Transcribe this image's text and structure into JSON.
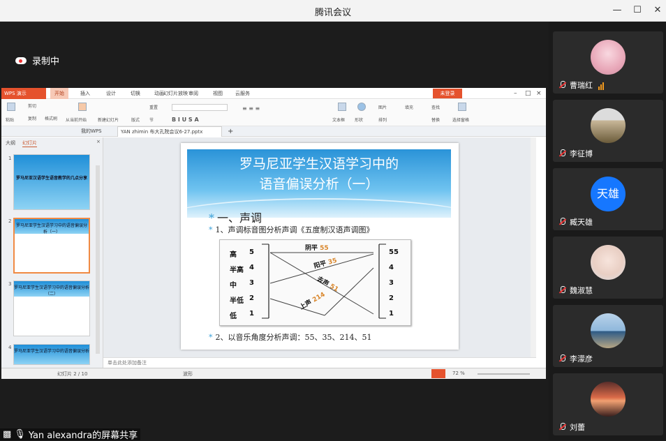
{
  "window": {
    "title": "腾讯会议"
  },
  "recording": {
    "label": "录制中"
  },
  "share_banner": {
    "label": "Yan alexandra的屏幕共享"
  },
  "wps": {
    "logo": "WPS 演示",
    "menus": [
      "开始",
      "插入",
      "设计",
      "切换",
      "动画",
      "幻灯片放映",
      "审阅",
      "视图",
      "云服务"
    ],
    "login": "未登录",
    "ribbon": [
      "粘贴",
      "剪切",
      "复制",
      "格式刷",
      "从当前开始",
      "新建幻灯片",
      "版式",
      "节",
      "重置",
      "文本框",
      "形状",
      "排列",
      "图片",
      "填充",
      "查找",
      "替换",
      "选择窗格"
    ],
    "doc_tabs": [
      "我的WPS",
      "YAN zhimin 布大孔院会议6-27.pptx"
    ],
    "pane_tabs": [
      "大纲",
      "幻灯片"
    ],
    "status": {
      "slide_counter": "幻灯片 2 / 10",
      "theme": "波形",
      "zoom": "72 %",
      "notes_hint": "单击此处添加备注"
    }
  },
  "slide": {
    "title_line1": "罗马尼亚学生汉语学习中的",
    "title_line2": "语音偏误分析（一）",
    "section": "一、声调",
    "bullet1": "1、声调标音图分析声调《五度制汉语声调图》",
    "bullet2": "2、以音乐角度分析声调：55、35、214、51",
    "levels": [
      {
        "name": "高",
        "num": "5",
        "right": "55"
      },
      {
        "name": "半高",
        "num": "4",
        "right": "4"
      },
      {
        "name": "中",
        "num": "3",
        "right": "3"
      },
      {
        "name": "半低",
        "num": "2",
        "right": "2"
      },
      {
        "name": "低",
        "num": "1",
        "right": "1"
      }
    ],
    "tones": [
      {
        "name": "阴平",
        "value": "55"
      },
      {
        "name": "阳平",
        "value": "35"
      },
      {
        "name": "去声",
        "value": "51"
      },
      {
        "name": "上声",
        "value": "214"
      }
    ]
  },
  "thumbs": [
    {
      "num": "1",
      "title": "罗马尼亚汉语学生语音教学的几点分享"
    },
    {
      "num": "2",
      "title": "罗马尼亚学生汉语学习中的语音偏误分析（一）"
    },
    {
      "num": "3",
      "title": "罗马尼亚学生汉语学习中的语音偏误分析（二）"
    },
    {
      "num": "4",
      "title": "罗马尼亚学生汉语学习中的语音偏误分析"
    }
  ],
  "participants": [
    {
      "name": "曹瑞红",
      "icon": "avatar-pink"
    },
    {
      "name": "李征博",
      "icon": "avatar-jeep"
    },
    {
      "name": "臧天雄",
      "initials": "天雄"
    },
    {
      "name": "魏淑慧",
      "icon": "avatar-girl"
    },
    {
      "name": "李濛彦",
      "icon": "avatar-lake"
    },
    {
      "name": "刘蕾",
      "icon": "avatar-sunset"
    }
  ],
  "colors": {
    "wps_orange": "#e5522d",
    "slide_blue": "#2a93d8",
    "tone_orange": "#d9862b",
    "initials_bg": "#1677ff"
  }
}
